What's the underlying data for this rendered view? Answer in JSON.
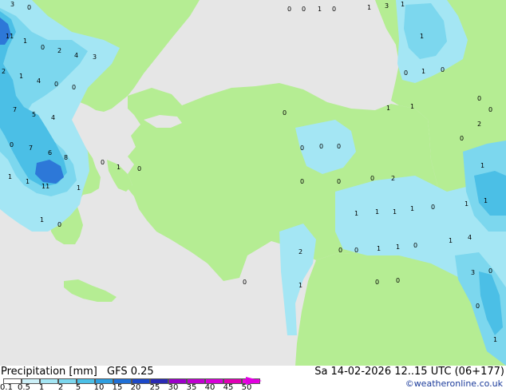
{
  "footer": {
    "title": "Precipitation [mm]",
    "model": "GFS 0.25",
    "datetime": "Sa 14-02-2026 12..15 UTC (06+177)",
    "credit": "©weatheronline.co.uk"
  },
  "legend": {
    "labels": [
      "0.1",
      "0.5",
      "1",
      "2",
      "5",
      "10",
      "15",
      "20",
      "25",
      "30",
      "35",
      "40",
      "45",
      "50"
    ],
    "colors": [
      "#ffffff",
      "#ccf0f8",
      "#a4e6f4",
      "#7cd7ee",
      "#4bbfe6",
      "#2d9ee0",
      "#1f6fd6",
      "#1c48c8",
      "#2a2ab4",
      "#9a00c8",
      "#c000d0",
      "#d800d8",
      "#e000b4",
      "#f000e0"
    ],
    "arrow_color": "#e000e0"
  },
  "colors": {
    "land": "#b5ed93",
    "land_dry": "#e6e6e6",
    "sea": "#e6e6e6",
    "precip_light": "#a4e6f4",
    "precip_mid": "#7cd7ee",
    "precip_heavy": "#4bbfe6",
    "precip_very_heavy": "#2d78d8"
  },
  "map_labels": [
    {
      "t": "3",
      "c": "#000"
    },
    {
      "t": "0",
      "c": "#000"
    },
    {
      "t": "11",
      "c": "#000"
    },
    {
      "t": "1",
      "c": "#000"
    },
    {
      "t": "0",
      "c": "#000"
    },
    {
      "t": "2",
      "c": "#000"
    },
    {
      "t": "4",
      "c": "#000"
    },
    {
      "t": "3",
      "c": "#000"
    },
    {
      "t": "2",
      "c": "#000"
    },
    {
      "t": "1",
      "c": "#000"
    },
    {
      "t": "4",
      "c": "#000"
    },
    {
      "t": "0",
      "c": "#000"
    },
    {
      "t": "0",
      "c": "#000"
    },
    {
      "t": "7",
      "c": "#000"
    },
    {
      "t": "5",
      "c": "#000"
    },
    {
      "t": "4",
      "c": "#000"
    },
    {
      "t": "0",
      "c": "#000"
    },
    {
      "t": "7",
      "c": "#000"
    },
    {
      "t": "6",
      "c": "#000"
    },
    {
      "t": "8",
      "c": "#000"
    },
    {
      "t": "11",
      "c": "#000"
    },
    {
      "t": "1",
      "c": "#000"
    },
    {
      "t": "1",
      "c": "#000"
    },
    {
      "t": "1",
      "c": "#000"
    },
    {
      "t": "0",
      "c": "#000"
    },
    {
      "t": "1",
      "c": "#000"
    },
    {
      "t": "1",
      "c": "#000"
    },
    {
      "t": "0",
      "c": "#000"
    },
    {
      "t": "0",
      "c": "#000"
    },
    {
      "t": "0",
      "c": "#000"
    },
    {
      "t": "0",
      "c": "#000"
    },
    {
      "t": "1",
      "c": "#000"
    },
    {
      "t": "0",
      "c": "#000"
    },
    {
      "t": "1",
      "c": "#000"
    },
    {
      "t": "3",
      "c": "#000"
    },
    {
      "t": "1",
      "c": "#000"
    },
    {
      "t": "1",
      "c": "#000"
    },
    {
      "t": "0",
      "c": "#000"
    },
    {
      "t": "1",
      "c": "#000"
    },
    {
      "t": "0",
      "c": "#000"
    },
    {
      "t": "0",
      "c": "#000"
    },
    {
      "t": "1",
      "c": "#000"
    },
    {
      "t": "1",
      "c": "#000"
    },
    {
      "t": "0",
      "c": "#000"
    },
    {
      "t": "0",
      "c": "#000"
    },
    {
      "t": "0",
      "c": "#000"
    },
    {
      "t": "2",
      "c": "#000"
    },
    {
      "t": "0",
      "c": "#000"
    },
    {
      "t": "0",
      "c": "#000"
    },
    {
      "t": "0",
      "c": "#000"
    },
    {
      "t": "0",
      "c": "#000"
    },
    {
      "t": "0",
      "c": "#000"
    },
    {
      "t": "0",
      "c": "#000"
    },
    {
      "t": "2",
      "c": "#000"
    },
    {
      "t": "1",
      "c": "#000"
    },
    {
      "t": "0",
      "c": "#000"
    },
    {
      "t": "1",
      "c": "#000"
    },
    {
      "t": "1",
      "c": "#000"
    },
    {
      "t": "1",
      "c": "#000"
    },
    {
      "t": "0",
      "c": "#000"
    },
    {
      "t": "0",
      "c": "#000"
    },
    {
      "t": "1",
      "c": "#000"
    },
    {
      "t": "1",
      "c": "#000"
    },
    {
      "t": "0",
      "c": "#000"
    },
    {
      "t": "2",
      "c": "#000"
    },
    {
      "t": "1",
      "c": "#000"
    },
    {
      "t": "0",
      "c": "#000"
    },
    {
      "t": "0",
      "c": "#000"
    },
    {
      "t": "0",
      "c": "#000"
    },
    {
      "t": "3",
      "c": "#000"
    },
    {
      "t": "0",
      "c": "#000"
    },
    {
      "t": "0",
      "c": "#000"
    },
    {
      "t": "1",
      "c": "#000"
    },
    {
      "t": "1",
      "c": "#000"
    },
    {
      "t": "4",
      "c": "#000"
    },
    {
      "t": "1",
      "c": "#000"
    },
    {
      "t": "1",
      "c": "#000"
    },
    {
      "t": "1",
      "c": "#000"
    }
  ]
}
